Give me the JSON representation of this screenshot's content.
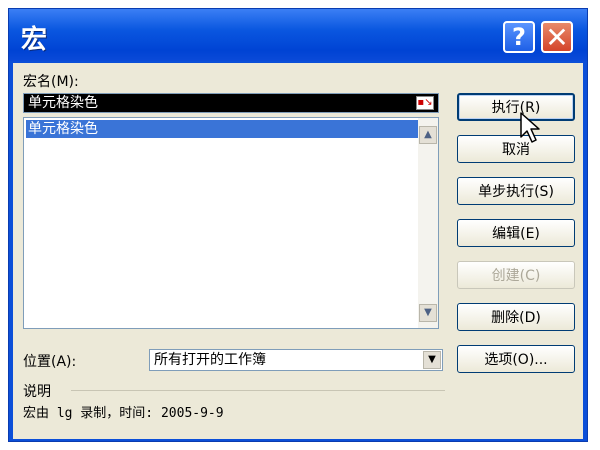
{
  "window": {
    "title": "宏",
    "help_glyph": "?",
    "close_glyph": "✕"
  },
  "macro_name": {
    "label": "宏名(M):",
    "value": "单元格染色",
    "icon": "collapse-dialog-icon"
  },
  "macro_list": {
    "items": [
      "单元格染色"
    ],
    "selected_index": 0
  },
  "buttons": {
    "run": "执行(R)",
    "cancel": "取消",
    "step_into": "单步执行(S)",
    "edit": "编辑(E)",
    "create": "创建(C)",
    "delete": "删除(D)",
    "options": "选项(O)..."
  },
  "location": {
    "label": "位置(A):",
    "value": "所有打开的工作簿"
  },
  "description": {
    "label": "说明",
    "text": "宏由 lg 录制，时间: 2005-9-9"
  },
  "colors": {
    "title_bar": "#0a57e0",
    "dialog_face": "#ece9d8",
    "selection": "#3a74d7"
  }
}
